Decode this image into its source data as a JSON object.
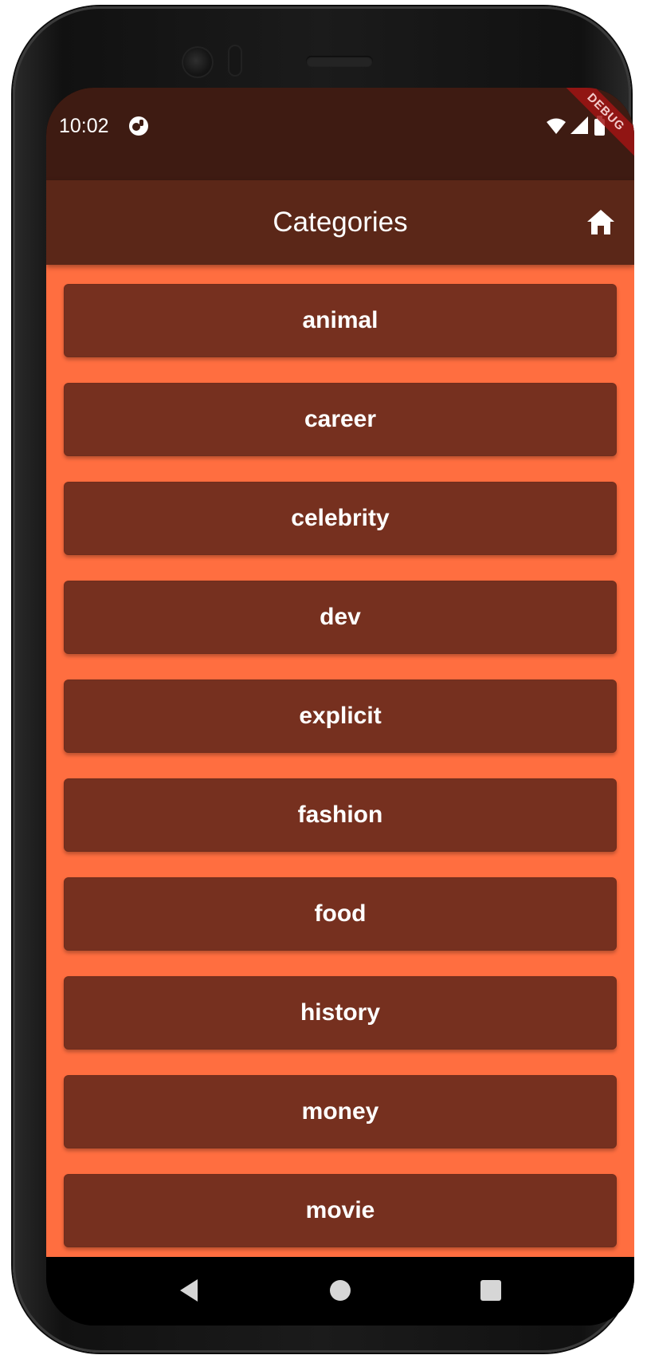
{
  "status_bar": {
    "time": "10:02",
    "debug_label": "DEBUG",
    "icons": [
      "app-notification-icon",
      "wifi-icon",
      "signal-icon",
      "battery-icon"
    ]
  },
  "app_bar": {
    "title": "Categories",
    "home_icon": "home-icon"
  },
  "categories": [
    "animal",
    "career",
    "celebrity",
    "dev",
    "explicit",
    "fashion",
    "food",
    "history",
    "money",
    "movie"
  ],
  "nav_bar": {
    "icons": [
      "back-icon",
      "home-circle-icon",
      "recents-icon"
    ]
  },
  "colors": {
    "status_bar": "#3e1b12",
    "app_bar": "#5b2718",
    "background": "#ff6e40",
    "button": "#76301f",
    "text": "#ffffff"
  }
}
